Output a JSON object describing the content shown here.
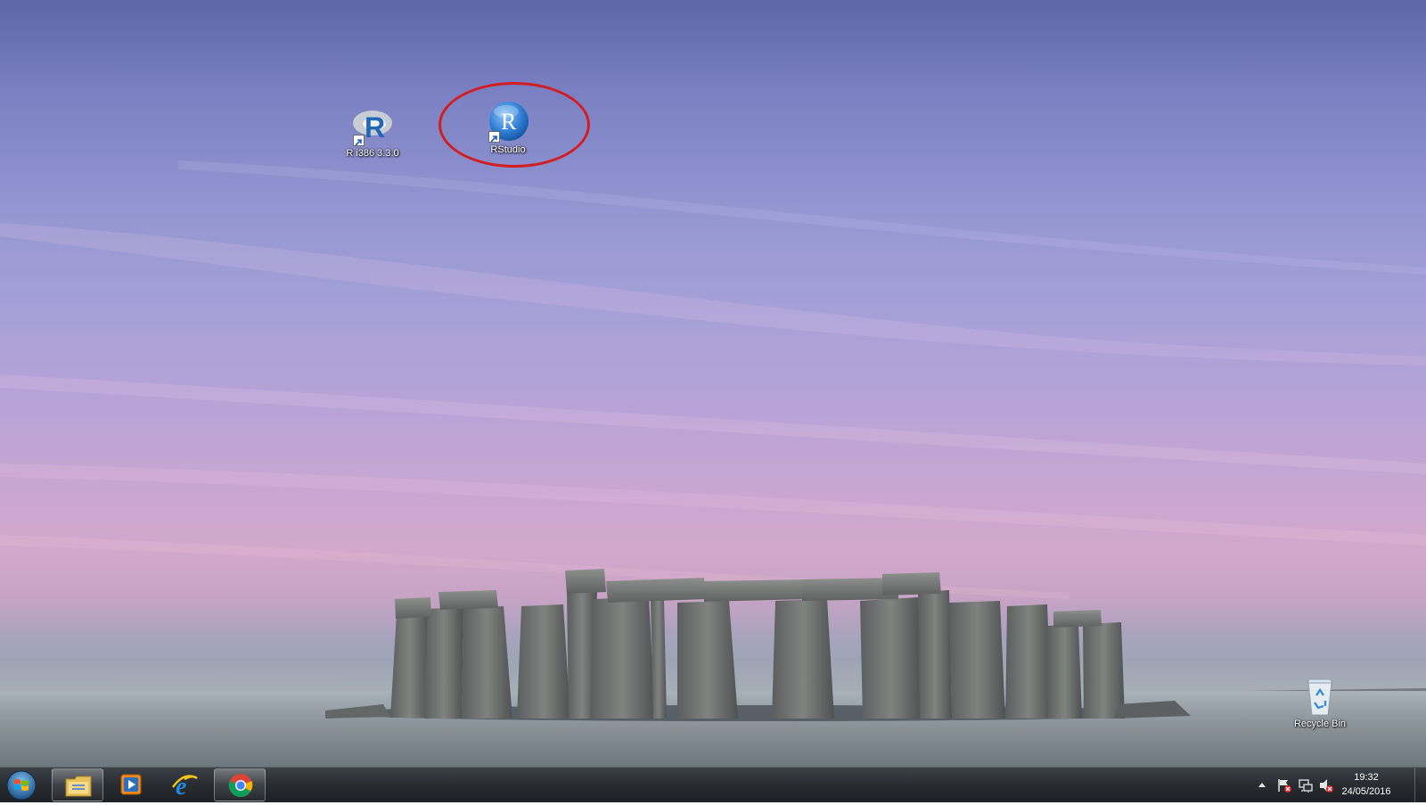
{
  "desktop": {
    "icons": [
      {
        "label": "R i386 3.3.0",
        "icon": "r-logo-icon"
      },
      {
        "label": "RStudio",
        "icon": "rstudio-icon"
      },
      {
        "label": "Recycle Bin",
        "icon": "recycle-bin-icon"
      }
    ],
    "annotation_color": "#d21e23"
  },
  "taskbar": {
    "start_icon": "windows-orb-icon",
    "pinned": [
      {
        "icon": "file-explorer-icon"
      },
      {
        "icon": "media-player-icon"
      },
      {
        "icon": "internet-explorer-icon"
      },
      {
        "icon": "chrome-icon",
        "active": true
      }
    ],
    "tray": {
      "icons": [
        "show-hidden-icons-icon",
        "action-center-icon",
        "network-icon",
        "volume-muted-icon"
      ],
      "time": "19:32",
      "date": "24/05/2016"
    }
  }
}
